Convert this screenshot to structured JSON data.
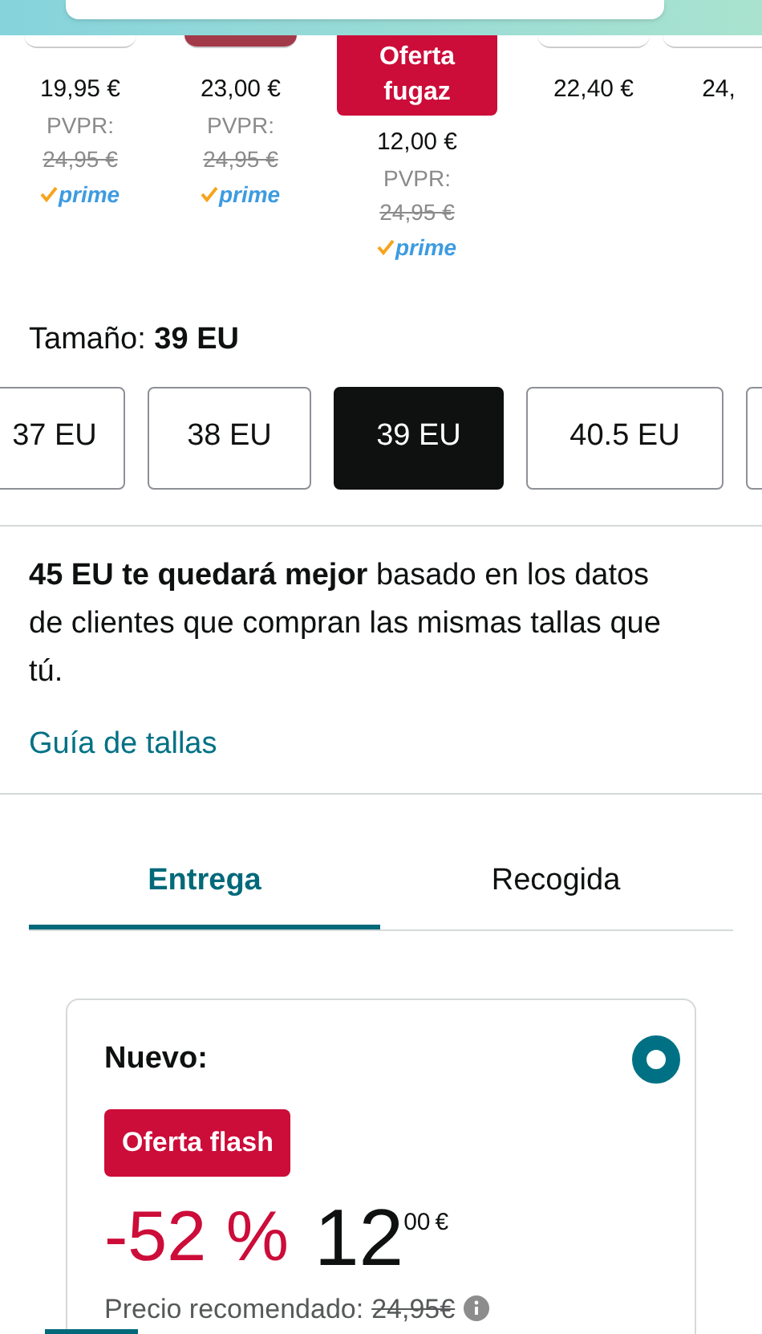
{
  "swatches": [
    {
      "price": "19,95 €",
      "list_label": "PVPR:",
      "list_price": "24,95 €",
      "prime": "prime",
      "color": "#ffffff"
    },
    {
      "price": "23,00 €",
      "list_label": "PVPR:",
      "list_price": "24,95 €",
      "prime": "prime",
      "color": "#a33a4a"
    },
    {
      "badge": "Oferta fugaz",
      "price": "12,00 €",
      "list_label": "PVPR:",
      "list_price": "24,95 €",
      "prime": "prime"
    },
    {
      "price": "22,40 €",
      "color": "#ffffff"
    },
    {
      "price": "24,",
      "color": "#ffffff"
    }
  ],
  "size": {
    "label": "Tamaño:",
    "value": "39 EU"
  },
  "sizes": [
    {
      "label": "37 EU",
      "selected": false
    },
    {
      "label": "38 EU",
      "selected": false
    },
    {
      "label": "39 EU",
      "selected": true
    },
    {
      "label": "40.5 EU",
      "selected": false
    }
  ],
  "fit_note": "**45 EU te quedará mejor** basado en los datos de clientes que compran las mismas tallas que tú.",
  "size_guide_link": "Guía de tallas",
  "tabs": [
    {
      "label": "Entrega",
      "selected": true
    },
    {
      "label": "Recogida",
      "selected": false
    }
  ],
  "offer": {
    "condition": "Nuevo:",
    "selected": true,
    "badge": "Oferta flash",
    "discount": "-52 %",
    "price_whole": "12",
    "price_fraction": "00",
    "currency": "€",
    "list_price_label": "Precio recomendado:",
    "list_price": "24,95€"
  }
}
